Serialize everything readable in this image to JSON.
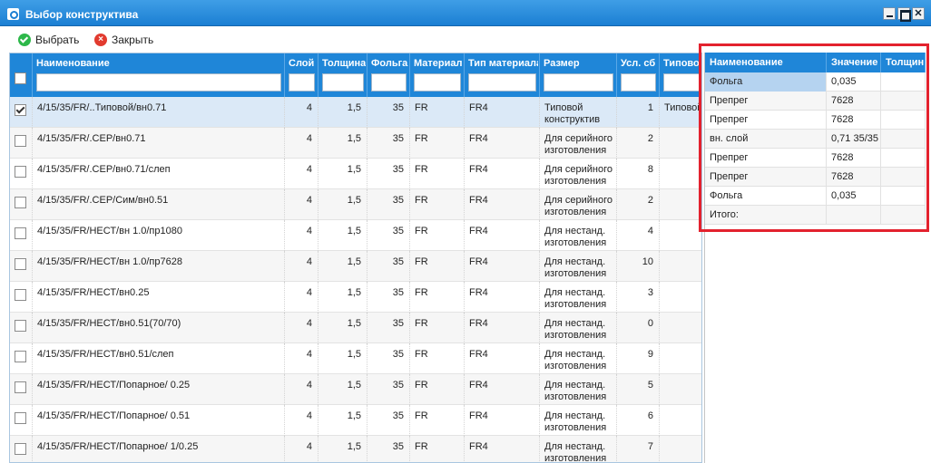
{
  "window": {
    "title": "Выбор конструктива"
  },
  "toolbar": {
    "select_label": "Выбрать",
    "close_label": "Закрыть"
  },
  "grid": {
    "columns": [
      {
        "key": "name",
        "label": "Наименование"
      },
      {
        "key": "layers",
        "label": "Слой"
      },
      {
        "key": "thickness",
        "label": "Толщина"
      },
      {
        "key": "foil",
        "label": "Фольга"
      },
      {
        "key": "material",
        "label": "Материал"
      },
      {
        "key": "material_type",
        "label": "Тип материала"
      },
      {
        "key": "size",
        "label": "Размер"
      },
      {
        "key": "cond",
        "label": "Усл. сб"
      },
      {
        "key": "typical",
        "label": "Типовой"
      }
    ],
    "rows": [
      {
        "checked": true,
        "name": "4/15/35/FR/..Типовой/вн0.71",
        "layers": "4",
        "thickness": "1,5",
        "foil": "35",
        "material": "FR",
        "material_type": "FR4",
        "size1": "Типовой",
        "size2": "конструктив",
        "cond": "1",
        "typical": "Типовой"
      },
      {
        "checked": false,
        "name": "4/15/35/FR/.СЕР/вн0.71",
        "layers": "4",
        "thickness": "1,5",
        "foil": "35",
        "material": "FR",
        "material_type": "FR4",
        "size1": "Для серийного",
        "size2": "изготовления",
        "cond": "2",
        "typical": ""
      },
      {
        "checked": false,
        "name": "4/15/35/FR/.СЕР/вн0.71/слеп",
        "layers": "4",
        "thickness": "1,5",
        "foil": "35",
        "material": "FR",
        "material_type": "FR4",
        "size1": "Для серийного",
        "size2": "изготовления",
        "cond": "8",
        "typical": ""
      },
      {
        "checked": false,
        "name": "4/15/35/FR/.СЕР/Сим/вн0.51",
        "layers": "4",
        "thickness": "1,5",
        "foil": "35",
        "material": "FR",
        "material_type": "FR4",
        "size1": "Для серийного",
        "size2": "изготовления",
        "cond": "2",
        "typical": ""
      },
      {
        "checked": false,
        "name": "4/15/35/FR/НЕСТ/вн 1.0/пр1080",
        "layers": "4",
        "thickness": "1,5",
        "foil": "35",
        "material": "FR",
        "material_type": "FR4",
        "size1": "Для нестанд.",
        "size2": "изготовления",
        "cond": "4",
        "typical": ""
      },
      {
        "checked": false,
        "name": "4/15/35/FR/НЕСТ/вн 1.0/пр7628",
        "layers": "4",
        "thickness": "1,5",
        "foil": "35",
        "material": "FR",
        "material_type": "FR4",
        "size1": "Для нестанд.",
        "size2": "изготовления",
        "cond": "10",
        "typical": ""
      },
      {
        "checked": false,
        "name": "4/15/35/FR/НЕСТ/вн0.25",
        "layers": "4",
        "thickness": "1,5",
        "foil": "35",
        "material": "FR",
        "material_type": "FR4",
        "size1": "Для нестанд.",
        "size2": "изготовления",
        "cond": "3",
        "typical": ""
      },
      {
        "checked": false,
        "name": "4/15/35/FR/НЕСТ/вн0.51(70/70)",
        "layers": "4",
        "thickness": "1,5",
        "foil": "35",
        "material": "FR",
        "material_type": "FR4",
        "size1": "Для нестанд.",
        "size2": "изготовления",
        "cond": "0",
        "typical": ""
      },
      {
        "checked": false,
        "name": "4/15/35/FR/НЕСТ/вн0.51/слеп",
        "layers": "4",
        "thickness": "1,5",
        "foil": "35",
        "material": "FR",
        "material_type": "FR4",
        "size1": "Для нестанд.",
        "size2": "изготовления",
        "cond": "9",
        "typical": ""
      },
      {
        "checked": false,
        "name": "4/15/35/FR/НЕСТ/Попарное/ 0.25",
        "layers": "4",
        "thickness": "1,5",
        "foil": "35",
        "material": "FR",
        "material_type": "FR4",
        "size1": "Для нестанд.",
        "size2": "изготовления",
        "cond": "5",
        "typical": ""
      },
      {
        "checked": false,
        "name": "4/15/35/FR/НЕСТ/Попарное/ 0.51",
        "layers": "4",
        "thickness": "1,5",
        "foil": "35",
        "material": "FR",
        "material_type": "FR4",
        "size1": "Для нестанд.",
        "size2": "изготовления",
        "cond": "6",
        "typical": ""
      },
      {
        "checked": false,
        "name": "4/15/35/FR/НЕСТ/Попарное/ 1/0.25",
        "layers": "4",
        "thickness": "1,5",
        "foil": "35",
        "material": "FR",
        "material_type": "FR4",
        "size1": "Для нестанд.",
        "size2": "изготовления",
        "cond": "7",
        "typical": ""
      }
    ]
  },
  "side": {
    "columns": [
      "Наименование",
      "Значение",
      "Толщин"
    ],
    "rows": [
      {
        "name": "Фольга",
        "value": "0,035",
        "thick": "",
        "selected": true
      },
      {
        "name": "Препрег",
        "value": "7628",
        "thick": ""
      },
      {
        "name": "Препрег",
        "value": "7628",
        "thick": ""
      },
      {
        "name": "вн. слой",
        "value": "0,71 35/35",
        "thick": ""
      },
      {
        "name": "Препрег",
        "value": "7628",
        "thick": ""
      },
      {
        "name": "Препрег",
        "value": "7628",
        "thick": ""
      },
      {
        "name": "Фольга",
        "value": "0,035",
        "thick": ""
      },
      {
        "name": "Итого:",
        "value": "",
        "thick": ""
      }
    ]
  }
}
